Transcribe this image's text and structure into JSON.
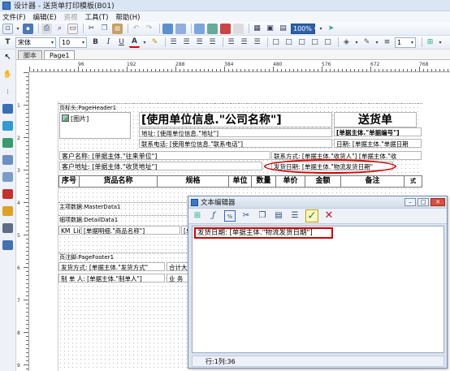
{
  "window": {
    "title": "设计器 - 送货单打印模板(B01)"
  },
  "menu": [
    {
      "label": "文件(F)",
      "enabled": true
    },
    {
      "label": "编辑(E)",
      "enabled": true
    },
    {
      "label": "资视",
      "enabled": false
    },
    {
      "label": "工具(T)",
      "enabled": true
    },
    {
      "label": "帮助(H)",
      "enabled": true
    }
  ],
  "toolbar": {
    "font_name": "宋体",
    "font_size": "10",
    "bold": "B",
    "italic": "I",
    "underline": "U",
    "font_color": "A",
    "zoom": "100%",
    "line_width": "1"
  },
  "tabs": [
    {
      "label": "脚本"
    },
    {
      "label": "Page1"
    }
  ],
  "ruler": {
    "h_numbers": [
      "96",
      "192",
      "288",
      "384",
      "480",
      "576",
      "672",
      "768"
    ],
    "v_numbers": [
      "1",
      "2",
      "3",
      "4",
      "5",
      "6",
      "7",
      "8",
      "9"
    ]
  },
  "report": {
    "page_header_band": "页标头:PageHeader1",
    "image_label": "[图片]",
    "company_name": "[使用单位信息.\"公司名称\"]",
    "title": "送货单",
    "address": "地址: [使用单位信息.\"地址\"]",
    "phone": "联系电话: [使用单位信息.\"联系电话\"]",
    "doc_no": "[单据主体.\"单据编号\"]",
    "doc_date": "日期: [单据主体.\"单据日期",
    "customer_name": "客户名称: [单据主体.\"往来单位\"]",
    "contact": "联系方式: [单据主体.\"收货人\"] [单据主体.\"收",
    "customer_address": "客户地址: [单据主体.\"收货地址\"]",
    "ship_date": "发货日期: [单据主体.\"物流发货日期\"",
    "columns": [
      "序号",
      "货品名称",
      "规格",
      "单位",
      "数量",
      "单价",
      "金额",
      "备注"
    ],
    "master_band": "主项数据:MasterData1",
    "detail_band": "细项数据:DetailData1",
    "detail_line": "KM_Lin",
    "detail_name": "[单据明细.\"商品名称\"]",
    "detail_spec": "[单据",
    "footer_band": "页注脚:PageFooter1",
    "ship_method": "发货方式: [单据主体.\"发货方式\"",
    "total_upper": "合计大",
    "maker": "制 单 人: [单据主体.\"制单人\"]",
    "clerk": "业 务",
    "side_text": "式"
  },
  "editor": {
    "title": "文本编辑器",
    "content": "发货日期: [单据主体.\"物流发货日期\"]",
    "status": "行:1列:36",
    "tool_icons": [
      "insert-field-icon",
      "function-icon",
      "format-icon",
      "cut-icon",
      "copy-icon",
      "paste-icon",
      "align-icon"
    ]
  },
  "colors": {
    "highlight": "#d40000",
    "accent": "#3a79c6"
  }
}
